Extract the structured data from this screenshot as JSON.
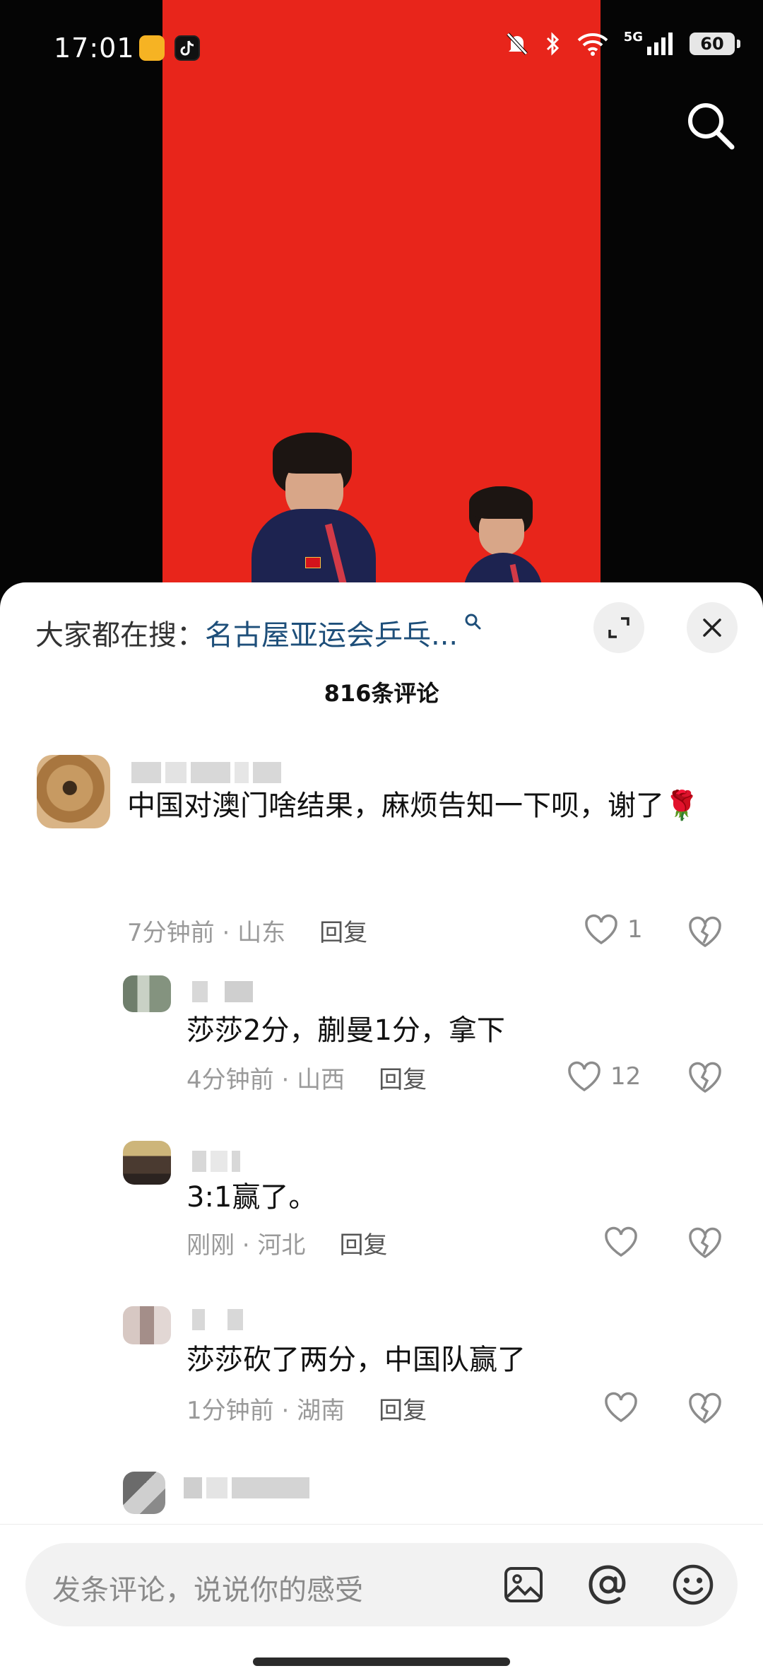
{
  "status_bar": {
    "time": "17:01",
    "network": "5G",
    "battery": "60",
    "icons": [
      "bell-off-icon",
      "bluetooth-icon",
      "wifi-icon",
      "signal-icon"
    ]
  },
  "video": {
    "search_icon": "search-icon"
  },
  "sheet": {
    "hot_search_prefix": "大家都在搜：",
    "hot_search_term": "名古屋亚运会乒乓...",
    "comment_count": "816条评论",
    "comments": [
      {
        "text": "中国对澳门啥结果，麻烦告知一下呗，谢了🌹",
        "time": "7分钟前",
        "location": "山东",
        "reply_label": "回复",
        "likes": "1"
      },
      {
        "text": "莎莎2分，蒯曼1分，拿下",
        "time": "4分钟前",
        "location": "山西",
        "reply_label": "回复",
        "likes": "12"
      },
      {
        "text": "3:1赢了。",
        "time": "刚刚",
        "location": "河北",
        "reply_label": "回复",
        "likes": ""
      },
      {
        "text": "莎莎砍了两分，中国队赢了",
        "time": "1分钟前",
        "location": "湖南",
        "reply_label": "回复",
        "likes": ""
      }
    ]
  },
  "bottom_bar": {
    "placeholder": "发条评论，说说你的感受",
    "tools": [
      "image-icon",
      "at-icon",
      "emoji-icon"
    ]
  },
  "colors": {
    "video_red": "#e8251b",
    "link_blue": "#1e4f7a",
    "meta_gray": "#9a9a9a"
  }
}
